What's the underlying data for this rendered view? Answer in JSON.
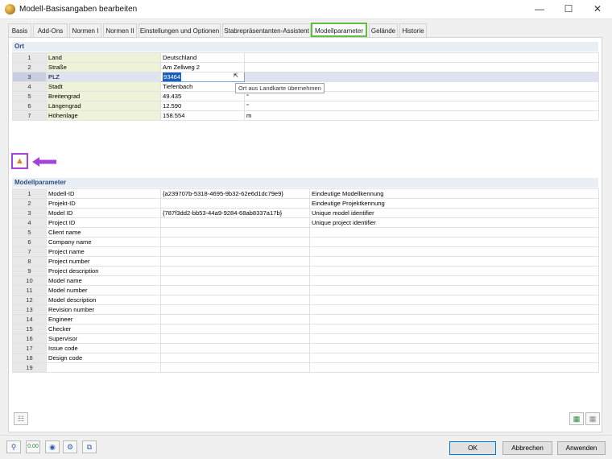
{
  "window": {
    "title": "Modell-Basisangaben bearbeiten"
  },
  "tabs": [
    {
      "label": "Basis"
    },
    {
      "label": "Add-Ons"
    },
    {
      "label": "Normen I"
    },
    {
      "label": "Normen II"
    },
    {
      "label": "Einstellungen und Optionen"
    },
    {
      "label": "Stabrepräsentanten-Assistent"
    },
    {
      "label": "Modellparameter"
    },
    {
      "label": "Gelände"
    },
    {
      "label": "Historie"
    }
  ],
  "ort": {
    "header": "Ort",
    "rows": [
      {
        "num": "1",
        "name": "Land",
        "value": "Deutschland",
        "unit": ""
      },
      {
        "num": "2",
        "name": "Straße",
        "value": "Am Zellweg 2",
        "unit": ""
      },
      {
        "num": "3",
        "name": "PLZ",
        "value": "93464",
        "unit": ""
      },
      {
        "num": "4",
        "name": "Stadt",
        "value": "Tiefenbach",
        "unit": ""
      },
      {
        "num": "5",
        "name": "Breitengrad",
        "value": "49.435",
        "unit": "°"
      },
      {
        "num": "6",
        "name": "Längengrad",
        "value": "12.590",
        "unit": "°"
      },
      {
        "num": "7",
        "name": "Höhenlage",
        "value": "158.554",
        "unit": "m"
      }
    ],
    "tooltip": "Ort aus Landkarte übernehmen"
  },
  "modellparameter": {
    "header": "Modellparameter",
    "rows": [
      {
        "num": "1",
        "name": "Modell-ID",
        "value": "{a239707b-5318-4695-9b32-62e6d1dc79e9}",
        "desc": "Eindeutige Modellkennung"
      },
      {
        "num": "2",
        "name": "Projekt-ID",
        "value": "",
        "desc": "Eindeutige Projektkennung"
      },
      {
        "num": "3",
        "name": "Model ID",
        "value": "{787f3dd2-bb53-44a9-9284-68ab8337a17b}",
        "desc": "Unique model identifier"
      },
      {
        "num": "4",
        "name": "Project ID",
        "value": "",
        "desc": "Unique project identifier"
      },
      {
        "num": "5",
        "name": "Client name",
        "value": "",
        "desc": ""
      },
      {
        "num": "6",
        "name": "Company name",
        "value": "",
        "desc": ""
      },
      {
        "num": "7",
        "name": "Project name",
        "value": "",
        "desc": ""
      },
      {
        "num": "8",
        "name": "Project number",
        "value": "",
        "desc": ""
      },
      {
        "num": "9",
        "name": "Project description",
        "value": "",
        "desc": ""
      },
      {
        "num": "10",
        "name": "Model name",
        "value": "",
        "desc": ""
      },
      {
        "num": "11",
        "name": "Model number",
        "value": "",
        "desc": ""
      },
      {
        "num": "12",
        "name": "Model description",
        "value": "",
        "desc": ""
      },
      {
        "num": "13",
        "name": "Revision number",
        "value": "",
        "desc": ""
      },
      {
        "num": "14",
        "name": "Engineer",
        "value": "",
        "desc": ""
      },
      {
        "num": "15",
        "name": "Checker",
        "value": "",
        "desc": ""
      },
      {
        "num": "16",
        "name": "Supervisor",
        "value": "",
        "desc": ""
      },
      {
        "num": "17",
        "name": "Issue code",
        "value": "",
        "desc": ""
      },
      {
        "num": "18",
        "name": "Design code",
        "value": "",
        "desc": ""
      },
      {
        "num": "19",
        "name": "",
        "value": "",
        "desc": ""
      }
    ]
  },
  "footer": {
    "ok_label": "OK",
    "cancel_label": "Abbrechen",
    "apply_label": "Anwenden",
    "zero_label": "0.00"
  },
  "colors": {
    "active_tab_border": "#5fbf3f",
    "highlight_border": "#a542d8",
    "selection": "#1c5fb8"
  }
}
